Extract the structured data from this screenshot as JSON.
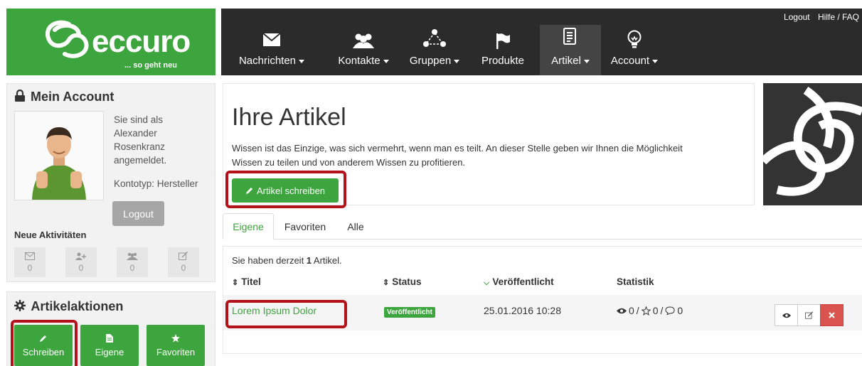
{
  "logo": {
    "brand": "eccuro",
    "tagline": "... so geht neu"
  },
  "top_links": {
    "logout": "Logout",
    "help": "Hilfe / FAQ"
  },
  "nav": [
    {
      "label": "Nachrichten",
      "icon": "envelope-icon",
      "has_dropdown": true
    },
    {
      "label": "Kontakte",
      "icon": "users-icon",
      "has_dropdown": true
    },
    {
      "label": "Gruppen",
      "icon": "group-network-icon",
      "has_dropdown": true
    },
    {
      "label": "Produkte",
      "icon": "flag-icon",
      "has_dropdown": false
    },
    {
      "label": "Artikel",
      "icon": "document-icon",
      "has_dropdown": true,
      "active": true
    },
    {
      "label": "Account",
      "icon": "lightbulb-icon",
      "has_dropdown": true
    }
  ],
  "account": {
    "title": "Mein Account",
    "logged_in_text": [
      "Sie sind als",
      "Alexander",
      "Rosenkranz",
      "angemeldet."
    ],
    "account_type": "Kontotyp: Hersteller",
    "logout_label": "Logout"
  },
  "activities": {
    "title": "Neue Aktivitäten",
    "items": [
      {
        "icon": "envelope-icon",
        "count": "0"
      },
      {
        "icon": "add-user-icon",
        "count": "0"
      },
      {
        "icon": "group-icon",
        "count": "0"
      },
      {
        "icon": "edit-icon",
        "count": "0"
      }
    ]
  },
  "article_actions": {
    "title": "Artikelaktionen",
    "buttons": [
      {
        "label": "Schreiben",
        "icon": "pencil-icon"
      },
      {
        "label": "Eigene",
        "icon": "file-icon"
      },
      {
        "label": "Favoriten",
        "icon": "star-icon"
      }
    ]
  },
  "main": {
    "title": "Ihre Artikel",
    "intro_line1": "Wissen ist das Einzige, was sich vermehrt, wenn man es teilt. An dieser Stelle geben wir Ihnen die Möglichkeit",
    "intro_line2": "Wissen zu teilen und von anderem Wissen zu profitieren.",
    "write_button": "Artikel schreiben"
  },
  "tabs": [
    {
      "label": "Eigene",
      "active": true
    },
    {
      "label": "Favoriten",
      "active": false
    },
    {
      "label": "Alle",
      "active": false
    }
  ],
  "list": {
    "count_prefix": "Sie haben derzeit ",
    "count": "1",
    "count_suffix": " Artikel.",
    "columns": [
      "Titel",
      "Status",
      "Veröffentlicht",
      "Statistik"
    ],
    "rows": [
      {
        "title": "Lorem Ipsum Dolor",
        "status": "Veröffentlicht",
        "published": "25.01.2016 10:28",
        "views": "0",
        "favorites": "0",
        "comments": "0"
      }
    ]
  },
  "colors": {
    "brand_green": "#3da53d",
    "nav_dark": "#2b2b2b",
    "highlight_red": "#b3121b",
    "danger": "#d9534f"
  }
}
